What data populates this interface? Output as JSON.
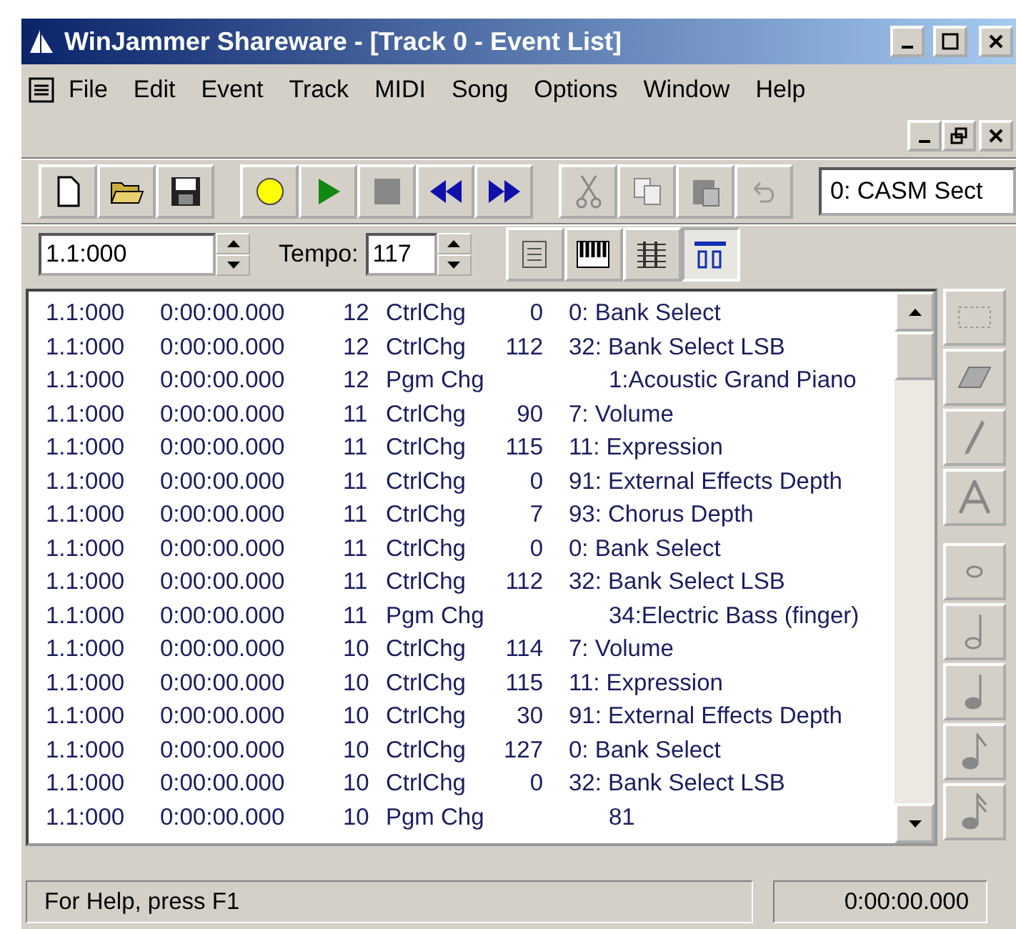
{
  "window": {
    "title": "WinJammer Shareware - [Track 0 - Event List]"
  },
  "menu": [
    "File",
    "Edit",
    "Event",
    "Track",
    "MIDI",
    "Song",
    "Options",
    "Window",
    "Help"
  ],
  "toolbar": {
    "section": "0: CASM Sect"
  },
  "position": {
    "value": "1.1:000"
  },
  "tempo": {
    "label": "Tempo:",
    "value": "117"
  },
  "views": [
    {
      "kind": "list",
      "selected": false
    },
    {
      "kind": "piano",
      "selected": false
    },
    {
      "kind": "staff",
      "selected": false
    },
    {
      "kind": "controller",
      "selected": true
    }
  ],
  "events": [
    {
      "kind": "ctrl",
      "time": "1.1:000",
      "clock": "0:00:00.000",
      "channel": "12",
      "type": "CtrlChg",
      "value": "0",
      "description": "0: Bank Select"
    },
    {
      "kind": "ctrl",
      "time": "1.1:000",
      "clock": "0:00:00.000",
      "channel": "12",
      "type": "CtrlChg",
      "value": "112",
      "description": "32: Bank Select LSB"
    },
    {
      "kind": "pgm",
      "time": "1.1:000",
      "clock": "0:00:00.000",
      "channel": "12",
      "type": "Pgm Chg",
      "description": "1:Acoustic Grand Piano"
    },
    {
      "kind": "ctrl",
      "time": "1.1:000",
      "clock": "0:00:00.000",
      "channel": "11",
      "type": "CtrlChg",
      "value": "90",
      "description": "7: Volume"
    },
    {
      "kind": "ctrl",
      "time": "1.1:000",
      "clock": "0:00:00.000",
      "channel": "11",
      "type": "CtrlChg",
      "value": "115",
      "description": "11: Expression"
    },
    {
      "kind": "ctrl",
      "time": "1.1:000",
      "clock": "0:00:00.000",
      "channel": "11",
      "type": "CtrlChg",
      "value": "0",
      "description": "91: External Effects Depth"
    },
    {
      "kind": "ctrl",
      "time": "1.1:000",
      "clock": "0:00:00.000",
      "channel": "11",
      "type": "CtrlChg",
      "value": "7",
      "description": "93: Chorus Depth"
    },
    {
      "kind": "ctrl",
      "time": "1.1:000",
      "clock": "0:00:00.000",
      "channel": "11",
      "type": "CtrlChg",
      "value": "0",
      "description": "0: Bank Select"
    },
    {
      "kind": "ctrl",
      "time": "1.1:000",
      "clock": "0:00:00.000",
      "channel": "11",
      "type": "CtrlChg",
      "value": "112",
      "description": "32: Bank Select LSB"
    },
    {
      "kind": "pgm",
      "time": "1.1:000",
      "clock": "0:00:00.000",
      "channel": "11",
      "type": "Pgm Chg",
      "description": "34:Electric Bass (finger)"
    },
    {
      "kind": "ctrl",
      "time": "1.1:000",
      "clock": "0:00:00.000",
      "channel": "10",
      "type": "CtrlChg",
      "value": "114",
      "description": "7: Volume"
    },
    {
      "kind": "ctrl",
      "time": "1.1:000",
      "clock": "0:00:00.000",
      "channel": "10",
      "type": "CtrlChg",
      "value": "115",
      "description": "11: Expression"
    },
    {
      "kind": "ctrl",
      "time": "1.1:000",
      "clock": "0:00:00.000",
      "channel": "10",
      "type": "CtrlChg",
      "value": "30",
      "description": "91: External Effects Depth"
    },
    {
      "kind": "ctrl",
      "time": "1.1:000",
      "clock": "0:00:00.000",
      "channel": "10",
      "type": "CtrlChg",
      "value": "127",
      "description": "0: Bank Select"
    },
    {
      "kind": "ctrl",
      "time": "1.1:000",
      "clock": "0:00:00.000",
      "channel": "10",
      "type": "CtrlChg",
      "value": "0",
      "description": "32: Bank Select LSB"
    },
    {
      "kind": "pgm",
      "time": "1.1:000",
      "clock": "0:00:00.000",
      "channel": "10",
      "type": "Pgm Chg",
      "description": "81"
    }
  ],
  "status_bar": {
    "help": "For Help, press F1",
    "time": "0:00:00.000"
  }
}
